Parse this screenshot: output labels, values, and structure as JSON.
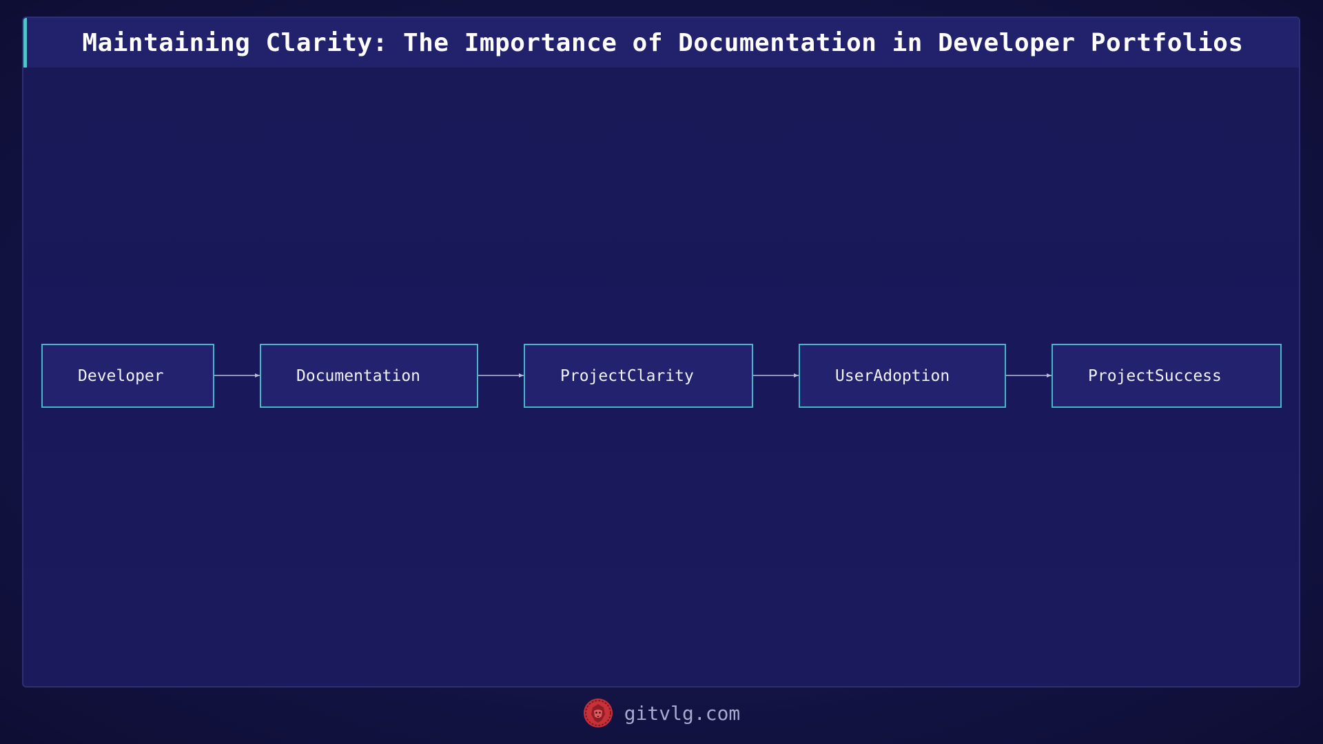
{
  "title": "Maintaining Clarity: The Importance of Documentation in Developer Portfolios",
  "nodes": [
    {
      "label": "Developer"
    },
    {
      "label": "Documentation"
    },
    {
      "label": "ProjectClarity"
    },
    {
      "label": "UserAdoption"
    },
    {
      "label": "ProjectSuccess"
    }
  ],
  "edges": [
    {
      "from": "Developer",
      "to": "Documentation"
    },
    {
      "from": "Documentation",
      "to": "ProjectClarity"
    },
    {
      "from": "ProjectClarity",
      "to": "UserAdoption"
    },
    {
      "from": "UserAdoption",
      "to": "ProjectSuccess"
    }
  ],
  "footer": {
    "logo_icon": "lion-icon",
    "site": "gitvlg.com"
  },
  "colors": {
    "background": "#141447",
    "panel": "#1a1957",
    "title_bar": "#22216c",
    "accent": "#4fc7c9",
    "node_fill": "#23226e",
    "node_border": "#47b8c9",
    "edge": "#b8bcd8",
    "logo": "#e0393e"
  }
}
